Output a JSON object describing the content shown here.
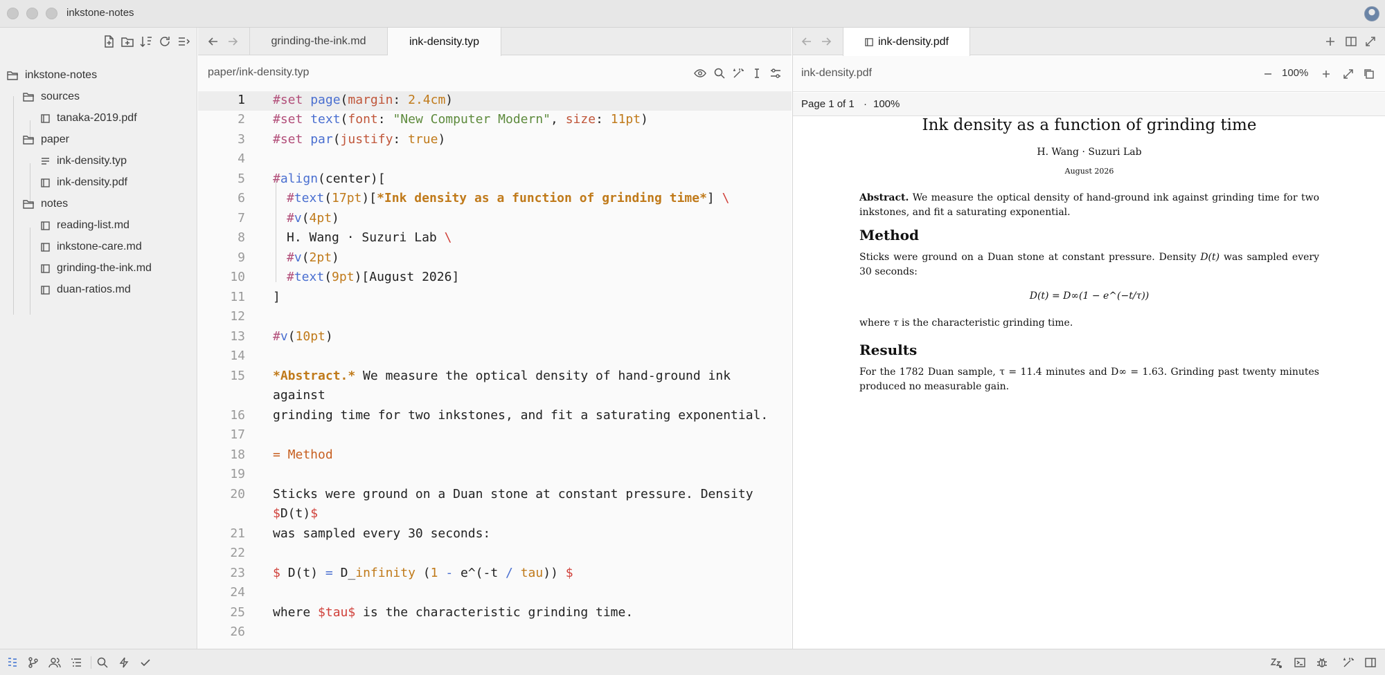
{
  "window": {
    "title": "inkstone-notes"
  },
  "sidebar": {
    "root": "inkstone-notes",
    "folders": [
      {
        "name": "sources",
        "files": [
          "tanaka-2019.pdf"
        ]
      },
      {
        "name": "paper",
        "files": [
          "ink-density.typ",
          "ink-density.pdf"
        ]
      },
      {
        "name": "notes",
        "files": [
          "reading-list.md",
          "inkstone-care.md",
          "grinding-the-ink.md",
          "duan-ratios.md"
        ]
      }
    ]
  },
  "editor": {
    "tabs": [
      "grinding-the-ink.md",
      "ink-density.typ"
    ],
    "active_tab": "ink-density.typ",
    "path": "paper/ink-density.typ",
    "current_line": 1,
    "line_numbers": [
      "1",
      "2",
      "3",
      "4",
      "5",
      "6",
      "7",
      "8",
      "9",
      "10",
      "11",
      "12",
      "13",
      "14",
      "15",
      "",
      "16",
      "17",
      "18",
      "19",
      "20",
      "",
      "21",
      "22",
      "23",
      "24",
      "25",
      "26"
    ],
    "code": {
      "l1_a": "#set ",
      "l1_b": "page",
      "l1_c": "(",
      "l1_d": "margin",
      "l1_e": ": ",
      "l1_f": "2.4cm",
      "l1_g": ")",
      "l2_a": "#set ",
      "l2_b": "text",
      "l2_c": "(",
      "l2_d": "font",
      "l2_e": ": ",
      "l2_f": "\"New Computer Modern\"",
      "l2_g": ", ",
      "l2_h": "size",
      "l2_i": ": ",
      "l2_j": "11pt",
      "l2_k": ")",
      "l3_a": "#set ",
      "l3_b": "par",
      "l3_c": "(",
      "l3_d": "justify",
      "l3_e": ": ",
      "l3_f": "true",
      "l3_g": ")",
      "l5_a": "#",
      "l5_b": "align",
      "l5_c": "(center)[",
      "l6_a": "#",
      "l6_b": "text",
      "l6_c": "(",
      "l6_d": "17pt",
      "l6_e": ")[",
      "l6_f": "*Ink density as a function of grinding time*",
      "l6_g": "] ",
      "l6_h": "\\",
      "l7_a": "#",
      "l7_b": "v",
      "l7_c": "(",
      "l7_d": "4pt",
      "l7_e": ")",
      "l8_a": "H. Wang · Suzuri Lab ",
      "l8_b": "\\",
      "l9_a": "#",
      "l9_b": "v",
      "l9_c": "(",
      "l9_d": "2pt",
      "l9_e": ")",
      "l10_a": "#",
      "l10_b": "text",
      "l10_c": "(",
      "l10_d": "9pt",
      "l10_e": ")[August 2026]",
      "l11": "]",
      "l13_a": "#",
      "l13_b": "v",
      "l13_c": "(",
      "l13_d": "10pt",
      "l13_e": ")",
      "l15_a": "*Abstract.*",
      "l15_b": " We measure the optical density of hand-ground ink",
      "l15_wrap": "against",
      "l16": "grinding time for two inkstones, and fit a saturating exponential.",
      "l18": "= Method",
      "l20": "Sticks were ground on a Duan stone at constant pressure. Density",
      "l20_wrap_a": "$",
      "l20_wrap_b": "D(t)",
      "l20_wrap_c": "$",
      "l21": "was sampled every 30 seconds:",
      "l23_a": "$ ",
      "l23_b": "D(t) ",
      "l23_c": "= ",
      "l23_d": "D_",
      "l23_e": "infinity",
      "l23_f": " (",
      "l23_g": "1",
      "l23_h": " - ",
      "l23_i": "e^(-t ",
      "l23_j": "/ ",
      "l23_k": "tau",
      "l23_l": ")) ",
      "l23_m": "$",
      "l25_a": "where ",
      "l25_b": "$tau$",
      "l25_c": " is the characteristic grinding time."
    }
  },
  "preview": {
    "tab": "ink-density.pdf",
    "file": "ink-density.pdf",
    "zoom": "100%",
    "page_info": "Page 1 of 1",
    "page_zoom": "100%",
    "doc": {
      "title": "Ink density as a function of grinding time",
      "author": "H. Wang  ·  Suzuri Lab",
      "date": "August 2026",
      "abstract_label": "Abstract.",
      "abstract_text": " We measure the optical density of hand-ground ink against grinding time for two inkstones, and fit a saturating exponential.",
      "method_heading": "Method",
      "method_text_a": "Sticks were ground on a Duan stone at constant pressure. Density ",
      "method_text_b": "D(t)",
      "method_text_c": " was sampled every 30 seconds:",
      "equation": "D(t) = D∞(1 − e^(−t/τ))",
      "where_a": "where ",
      "where_b": "τ",
      "where_c": " is the characteristic grinding time.",
      "results_heading": "Results",
      "results_text": "For the 1782 Duan sample, τ = 11.4 minutes and D∞ = 1.63. Grinding past twenty minutes produced no measurable gain."
    }
  }
}
